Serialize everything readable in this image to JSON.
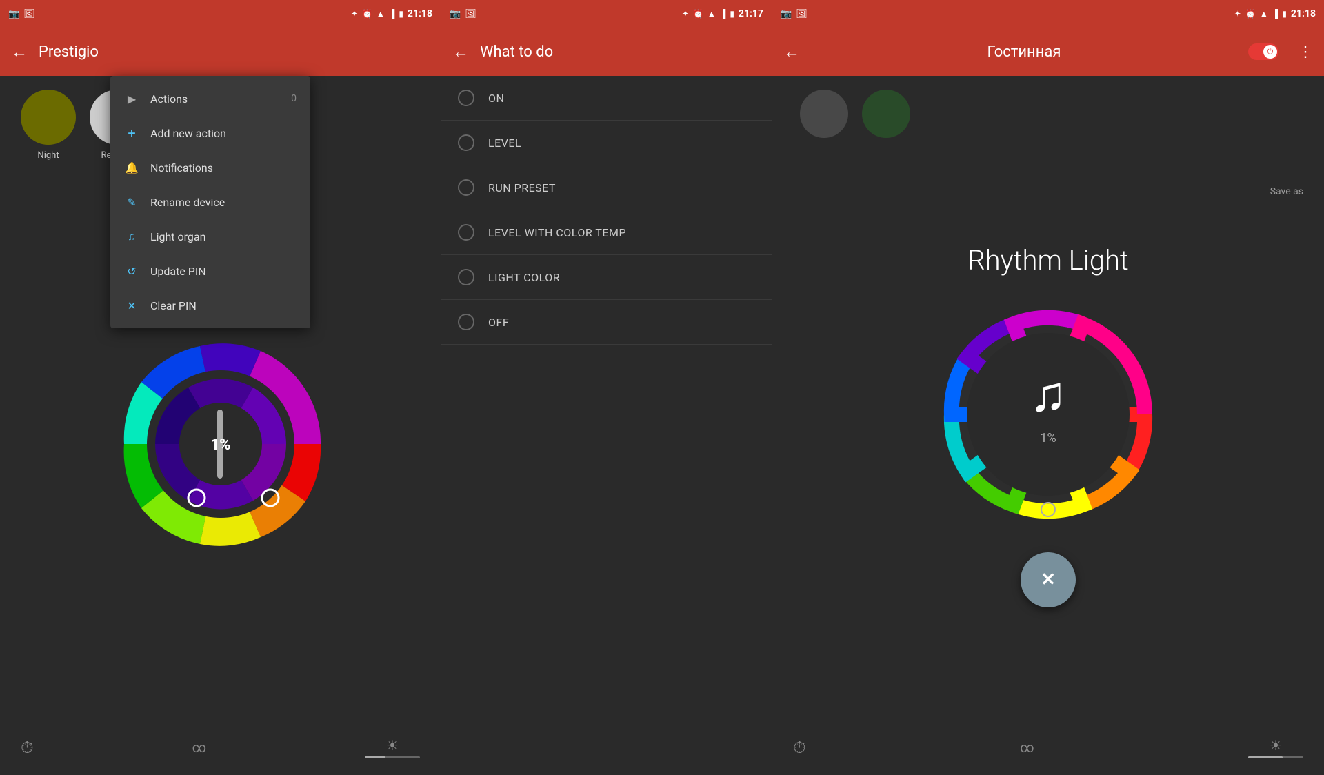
{
  "panel1": {
    "statusBar": {
      "time": "21:18",
      "leftIcons": [
        "📷",
        "🖼"
      ],
      "rightIcons": [
        "bt",
        "⏰",
        "wifi",
        "signal",
        "battery"
      ]
    },
    "appBar": {
      "back": "←",
      "title": "Prestigio"
    },
    "presets": [
      {
        "label": "Night",
        "color": "#6b6b00"
      },
      {
        "label": "Reading",
        "color": "#cccccc"
      }
    ],
    "colorWheel": {
      "percentLabel": "1%"
    },
    "menu": {
      "items": [
        {
          "icon": "▶",
          "label": "Actions",
          "badge": "0"
        },
        {
          "icon": "+",
          "label": "Add new action",
          "badge": ""
        },
        {
          "icon": "🔔",
          "label": "Notifications",
          "badge": ""
        },
        {
          "icon": "✏",
          "label": "Rename device",
          "badge": ""
        },
        {
          "icon": "♫",
          "label": "Light organ",
          "badge": ""
        },
        {
          "icon": "↺",
          "label": "Update PIN",
          "badge": ""
        },
        {
          "icon": "✕",
          "label": "Clear PIN",
          "badge": ""
        }
      ]
    }
  },
  "panel2": {
    "statusBar": {
      "time": "21:17"
    },
    "appBar": {
      "back": "←",
      "title": "What to do"
    },
    "listItems": [
      {
        "label": "ON"
      },
      {
        "label": "LEVEL"
      },
      {
        "label": "RUN PRESET"
      },
      {
        "label": "LEVEL WITH COLOR TEMP"
      },
      {
        "label": "LIGHT COLOR"
      },
      {
        "label": "OFF"
      }
    ]
  },
  "panel3": {
    "statusBar": {
      "time": "21:18"
    },
    "appBar": {
      "back": "←",
      "title": "Гостинная",
      "moreBtn": "⋮"
    },
    "presets": [
      {
        "color": "#555555"
      },
      {
        "color": "#2a5a2a"
      }
    ],
    "rhythmTitle": "Rhythm Light",
    "saveAsLabel": "Save as",
    "percentLabel": "1%",
    "closeBtn": "✕"
  }
}
